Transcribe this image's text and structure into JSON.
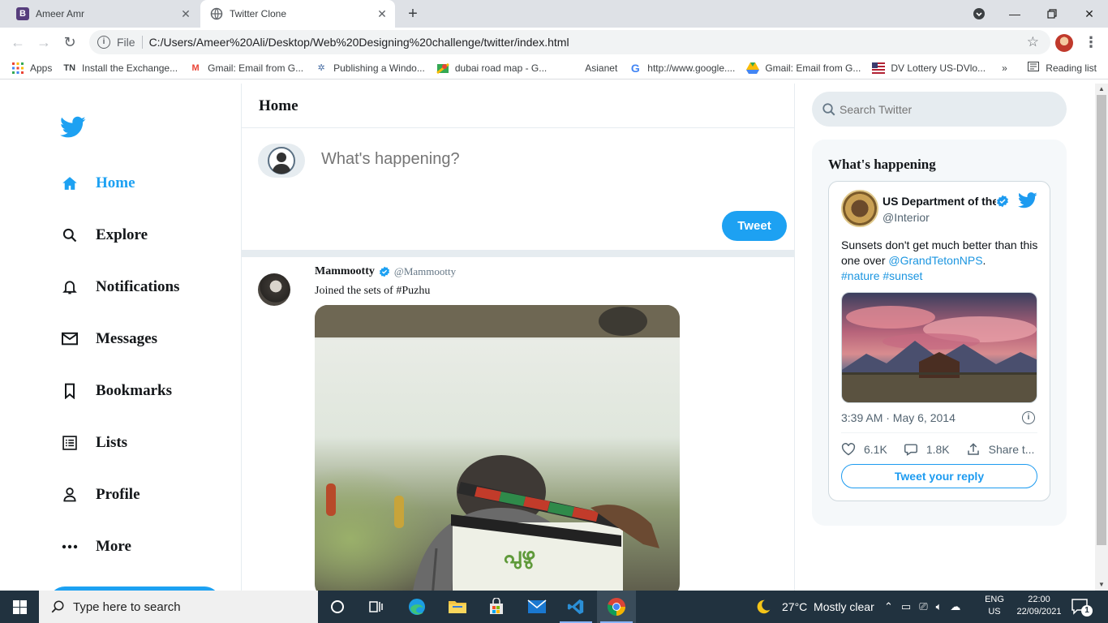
{
  "browser": {
    "tabs": [
      {
        "title": "Ameer Amr",
        "favicon_letter": "B"
      },
      {
        "title": "Twitter Clone"
      }
    ],
    "url_scheme": "File",
    "url": "C:/Users/Ameer%20Ali/Desktop/Web%20Designing%20challenge/twitter/index.html",
    "bookmarks": [
      {
        "label": "Apps",
        "icon": "apps-grid-icon"
      },
      {
        "label": "Install the Exchange...",
        "icon_text": "TN"
      },
      {
        "label": "Gmail: Email from G...",
        "icon": "gmail-icon"
      },
      {
        "label": "Publishing a Windo...",
        "icon": "bug-icon"
      },
      {
        "label": "dubai road map - G...",
        "icon": "maps-icon"
      },
      {
        "label": "Asianet",
        "icon": "blank-icon"
      },
      {
        "label": "http://www.google....",
        "icon": "google-icon"
      },
      {
        "label": "Gmail: Email from G...",
        "icon": "gmail-drive-icon"
      },
      {
        "label": "DV Lottery US-DVlo...",
        "icon": "usa-flag-icon"
      }
    ],
    "more_bookmarks": "»",
    "reading_list": "Reading list"
  },
  "sidebar": {
    "items": [
      {
        "label": "Home",
        "icon": "home-icon",
        "active": true
      },
      {
        "label": "Explore",
        "icon": "search-icon"
      },
      {
        "label": "Notifications",
        "icon": "bell-icon"
      },
      {
        "label": "Messages",
        "icon": "mail-icon"
      },
      {
        "label": "Bookmarks",
        "icon": "bookmark-icon"
      },
      {
        "label": "Lists",
        "icon": "list-icon"
      },
      {
        "label": "Profile",
        "icon": "person-icon"
      },
      {
        "label": "More",
        "icon": "more-dots-icon"
      }
    ]
  },
  "feed": {
    "title": "Home",
    "composer_placeholder": "What's happening?",
    "tweet_button": "Tweet",
    "post": {
      "name": "Mammootty",
      "handle": "@Mammootty",
      "text": "Joined the sets of #Puzhu"
    }
  },
  "widgets": {
    "search_placeholder": "Search Twitter",
    "trends_title": "What's happening",
    "embed": {
      "name": "US Department of the Interior",
      "handle": "@Interior",
      "text_prefix": "Sunsets don't get much better than this one over ",
      "mention": "@GrandTetonNPS",
      "text_suffix": ".",
      "hashtags": "#nature #sunset",
      "timestamp": "3:39 AM · May 6, 2014",
      "likes": "6.1K",
      "replies": "1.8K",
      "share": "Share t...",
      "reply_button": "Tweet your reply"
    }
  },
  "taskbar": {
    "search_placeholder": "Type here to search",
    "weather": "27°C  Mostly clear",
    "lang_top": "ENG",
    "lang_bottom": "US",
    "time": "22:00",
    "date": "22/09/2021",
    "notification_count": "1"
  },
  "colors": {
    "twitter_blue": "#1da1f2",
    "taskbar": "#21323f"
  }
}
